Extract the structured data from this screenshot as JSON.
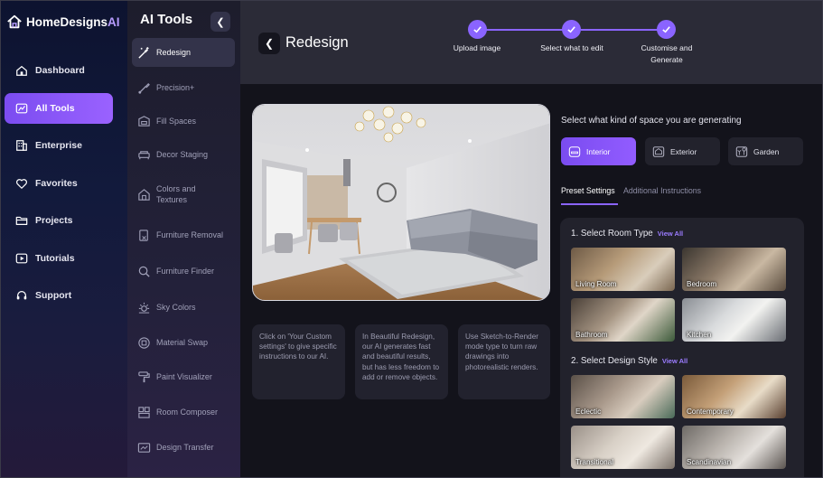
{
  "brand": {
    "name_part1": "HomeDesigns",
    "name_part2": "AI"
  },
  "sidebar": {
    "items": [
      {
        "label": "Dashboard",
        "icon": "dashboard-icon"
      },
      {
        "label": "All Tools",
        "icon": "tools-icon",
        "active": true
      },
      {
        "label": "Enterprise",
        "icon": "enterprise-icon"
      },
      {
        "label": "Favorites",
        "icon": "heart-icon"
      },
      {
        "label": "Projects",
        "icon": "folder-icon"
      },
      {
        "label": "Tutorials",
        "icon": "play-icon"
      },
      {
        "label": "Support",
        "icon": "headset-icon"
      }
    ]
  },
  "tools": {
    "title": "AI Tools",
    "items": [
      {
        "label": "Redesign",
        "icon": "magic-wand-icon",
        "active": true
      },
      {
        "label": "Precision+",
        "icon": "brush-icon"
      },
      {
        "label": "Fill Spaces",
        "icon": "sofa-icon"
      },
      {
        "label": "Decor Staging",
        "icon": "sofa-staging-icon"
      },
      {
        "label": "Colors and\nTextures",
        "icon": "palette-icon"
      },
      {
        "label": "Furniture Removal",
        "icon": "eraser-icon"
      },
      {
        "label": "Furniture Finder",
        "icon": "search-icon"
      },
      {
        "label": "Sky Colors",
        "icon": "sun-icon"
      },
      {
        "label": "Material Swap",
        "icon": "swap-icon"
      },
      {
        "label": "Paint Visualizer",
        "icon": "paint-roller-icon"
      },
      {
        "label": "Room Composer",
        "icon": "layout-icon"
      },
      {
        "label": "Design Transfer",
        "icon": "transfer-icon"
      }
    ]
  },
  "header": {
    "title": "Redesign",
    "steps": [
      {
        "label": "Upload image",
        "done": true
      },
      {
        "label": "Select what to edit",
        "done": true
      },
      {
        "label": "Customise and Generate",
        "done": true
      }
    ]
  },
  "info_cards": [
    "Click on 'Your Custom settings' to give specific instructions to our AI.",
    "In Beautiful Redesign, our AI generates fast and beautiful results, but has less freedom to add or remove objects.",
    "Use Sketch-to-Render mode type to turn raw drawings into photorealistic renders."
  ],
  "space": {
    "question": "Select what kind of space you are generating",
    "options": [
      {
        "label": "Interior",
        "icon": "interior-icon",
        "active": true
      },
      {
        "label": "Exterior",
        "icon": "exterior-icon"
      },
      {
        "label": "Garden",
        "icon": "garden-icon"
      }
    ]
  },
  "tabs": [
    {
      "label": "Preset Settings",
      "active": true
    },
    {
      "label": "Additional Instructions"
    }
  ],
  "room_type": {
    "title": "1. Select Room Type",
    "view_all": "View All",
    "cards": [
      "Living Room",
      "Bedroom",
      "Bathroom",
      "Kitchen"
    ]
  },
  "design_style": {
    "title": "2. Select Design Style",
    "view_all": "View All",
    "cards": [
      "Eclectic",
      "Contemporary",
      "Transitional",
      "Scandinavian"
    ]
  },
  "colors": {
    "accent": "#8a64ff",
    "active_gradient_start": "#7b4cf0",
    "active_gradient_end": "#9a62ff"
  }
}
